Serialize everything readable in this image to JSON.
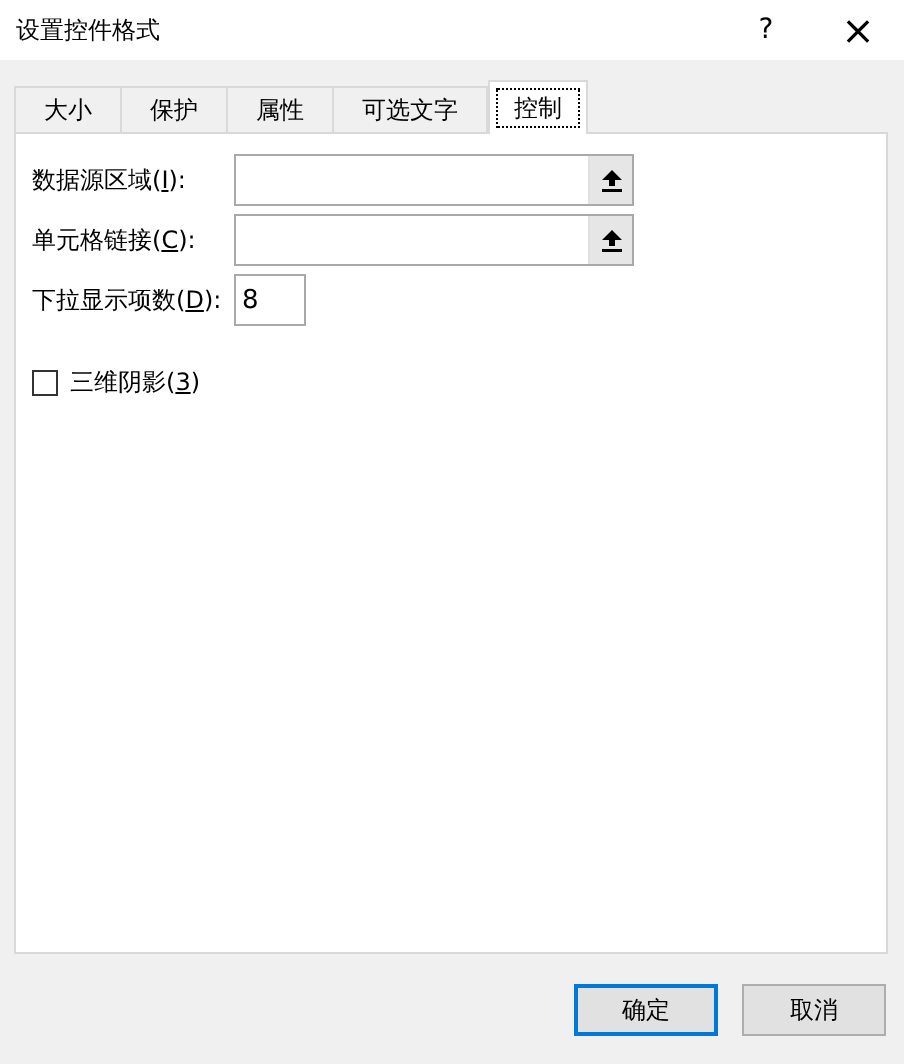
{
  "window": {
    "title": "设置控件格式",
    "help": "?",
    "close": "×"
  },
  "tabs": [
    {
      "label": "大小",
      "selected": false
    },
    {
      "label": "保护",
      "selected": false
    },
    {
      "label": "属性",
      "selected": false
    },
    {
      "label": "可选文字",
      "selected": false
    },
    {
      "label": "控制",
      "selected": true
    }
  ],
  "fields": [
    {
      "kind": "range",
      "before": "数据源区域(",
      "key": "I",
      "after": "):"
    },
    {
      "kind": "range",
      "before": "单元格链接(",
      "key": "C",
      "after": "):"
    },
    {
      "kind": "number",
      "before": "下拉显示项数(",
      "key": "D",
      "after": "):",
      "value": "8"
    }
  ],
  "shading": {
    "before": "三维阴影(",
    "key": "3",
    "after": ")",
    "checked": false
  },
  "buttons": [
    {
      "label": "确定",
      "default": true
    },
    {
      "label": "取消",
      "default": false
    }
  ]
}
